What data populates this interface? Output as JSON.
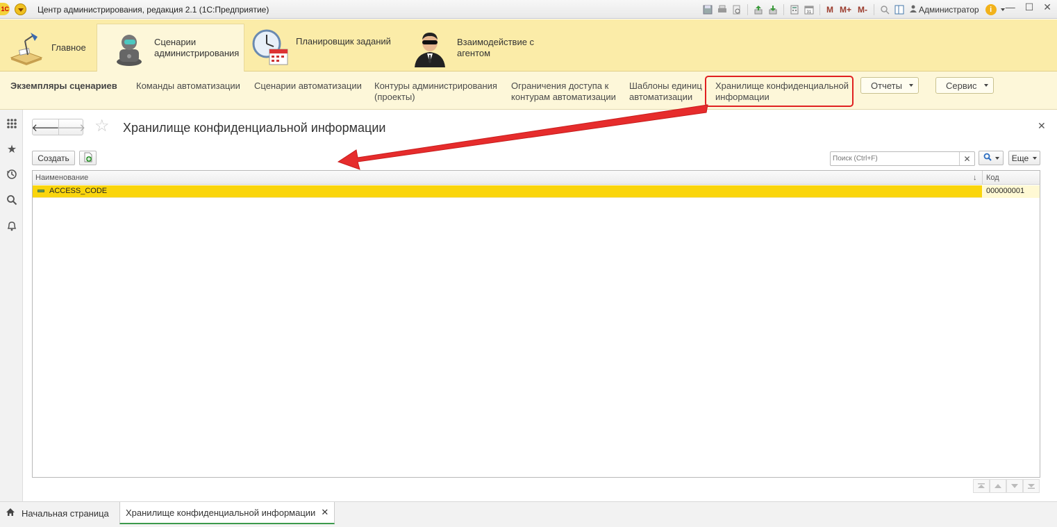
{
  "window": {
    "title": "Центр администрирования, редакция 2.1  (1С:Предприятие)",
    "logo_text": "1С",
    "user": "Администратор",
    "memory_buttons": [
      "M",
      "M+",
      "M-"
    ]
  },
  "sections": [
    {
      "label": "Главное",
      "icon": "desk-lamp-icon"
    },
    {
      "label_lines": [
        "Сценарии",
        "администрирования"
      ],
      "icon": "robot-icon",
      "active": true
    },
    {
      "label": "Планировщик заданий",
      "icon": "clock-calendar-icon"
    },
    {
      "label_lines": [
        "Взаимодействие с",
        "агентом"
      ],
      "icon": "agent-icon"
    }
  ],
  "functions": [
    {
      "label_lines": [
        "Экземпляры сценариев"
      ],
      "bold": true
    },
    {
      "label_lines": [
        "Команды автоматизации"
      ]
    },
    {
      "label_lines": [
        "Сценарии автоматизации"
      ]
    },
    {
      "label_lines": [
        "Контуры администрирования",
        "(проекты)"
      ]
    },
    {
      "label_lines": [
        "Ограничения доступа к",
        "контурам автоматизации"
      ]
    },
    {
      "label_lines": [
        "Шаблоны единиц",
        "автоматизации"
      ]
    },
    {
      "label_lines": [
        "Хранилище конфиденциальной",
        "информации"
      ],
      "highlighted": true
    }
  ],
  "function_menus": [
    "Отчеты",
    "Сервис"
  ],
  "form": {
    "title": "Хранилище конфиденциальной информации",
    "create_label": "Создать",
    "search_placeholder": "Поиск (Ctrl+F)",
    "more_label": "Еще",
    "columns": [
      "Наименование",
      "Код"
    ],
    "rows": [
      {
        "name": "ACCESS_CODE",
        "code": "000000001"
      }
    ]
  },
  "bottom_tabs": [
    "Начальная страница",
    "Хранилище конфиденциальной информации"
  ],
  "colors": {
    "section_bg": "#fbeca8",
    "function_bg": "#fdf7d9",
    "selected_row": "#fad50c",
    "highlight_red": "#e02020",
    "active_tab_underline": "#3c9a4c"
  }
}
